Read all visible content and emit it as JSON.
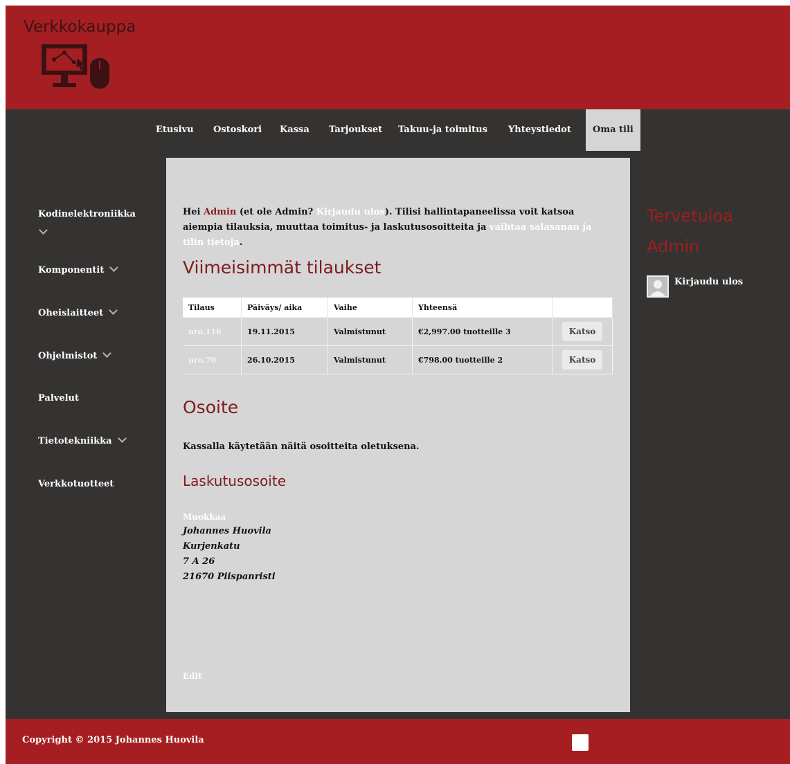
{
  "header": {
    "site_title": "Verkkokauppa"
  },
  "nav": [
    {
      "label": "Etusivu"
    },
    {
      "label": "Ostoskori"
    },
    {
      "label": "Kassa"
    },
    {
      "label": "Tarjoukset"
    },
    {
      "label": "Takuu-ja toimitus"
    },
    {
      "label": "Yhteystiedot"
    },
    {
      "label": "Oma tili"
    }
  ],
  "sidebar": [
    {
      "label": "Kodinelektroniikka"
    },
    {
      "label": "Komponentit"
    },
    {
      "label": "Oheislaitteet"
    },
    {
      "label": "Ohjelmistot"
    },
    {
      "label": "Palvelut"
    },
    {
      "label": "Tietotekniikka"
    },
    {
      "label": "Verkkotuotteet"
    }
  ],
  "account": {
    "intro": {
      "p1": "Hei ",
      "admin": "Admin",
      "p2": " (et ole Admin? ",
      "logout": "Kirjaudu ulos",
      "p3": "). Tilisi hallintapaneelissa voit katsoa aiempia tilauksia, muuttaa toimitus- ja laskutusosoitteita ja ",
      "change": "vaihtaa salasanan ja tilin tietoja",
      "p4": "."
    },
    "orders_heading": "Viimeisimmät tilaukset",
    "orders_headers": [
      "Tilaus",
      "Päiväys/ aika",
      "Vaihe",
      "Yhteensä"
    ],
    "orders": [
      {
        "nro": "nro.116",
        "date": "19.11.2015",
        "status": "Valmistunut",
        "total": "€2,997.00 tuotteille 3",
        "action": "Katso"
      },
      {
        "nro": "nro.70",
        "date": "26.10.2015",
        "status": "Valmistunut",
        "total": "€798.00 tuotteille 2",
        "action": "Katso"
      }
    ],
    "address_heading": "Osoite",
    "address_note": "Kassalla käytetään näitä osoitteita oletuksena.",
    "billing_heading": "Laskutusosoite",
    "edit_address": "Muokkaa",
    "address_lines": [
      "Johannes Huovila",
      "Kurjenkatu",
      "7 A 26",
      "21670 Piispanristi"
    ],
    "edit_link": "Edit"
  },
  "right_widget": {
    "welcome_line1": "Tervetuloa",
    "welcome_line2": "Admin",
    "logout": "Kirjaudu ulos"
  },
  "footer": {
    "copyright": "Copyright © 2015 Johannes Huovila"
  },
  "colors": {
    "brand_red": "#a51f22",
    "dark_bg": "#353331",
    "content_bg": "#d6d6d6",
    "heading": "#7e1b1e"
  }
}
